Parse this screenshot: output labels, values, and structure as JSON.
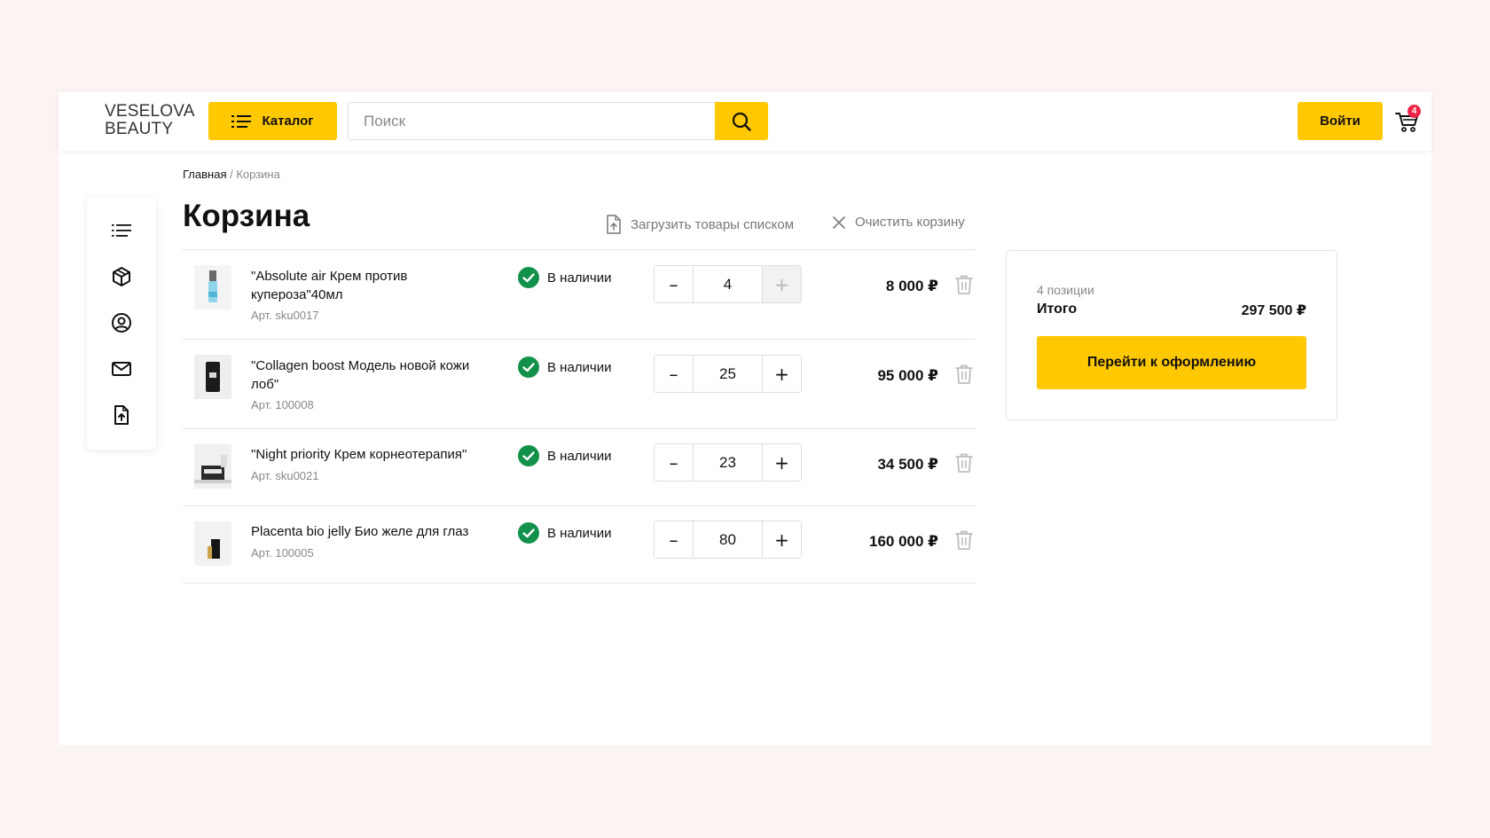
{
  "header": {
    "logo_line1": "VESELOVA",
    "logo_line2": "BEAUTY",
    "catalog_label": "Каталог",
    "search_placeholder": "Поиск",
    "login_label": "Войти",
    "cart_count": "4",
    "accent_color": "#ffc800",
    "badge_color": "#ee2244"
  },
  "sidebar": {
    "icons": [
      "list-icon",
      "box-icon",
      "user-circle-icon",
      "mail-icon",
      "file-upload-icon"
    ]
  },
  "breadcrumb": {
    "home": "Главная",
    "separator": " / ",
    "current": "Корзина"
  },
  "page": {
    "title": "Корзина",
    "upload_label": "Загрузить товары списком",
    "clear_label": "Очистить корзину"
  },
  "cart": {
    "items": [
      {
        "name": "\"Absolute air Крем против купероза\"40мл",
        "sku": "Арт. sku0017",
        "stock": "В наличии",
        "quantity": "4",
        "price": "8 000 ₽"
      },
      {
        "name": "\"Collagen boost Модель новой кожи лоб\"",
        "sku": "Арт. 100008",
        "stock": "В наличии",
        "quantity": "25",
        "price": "95 000 ₽"
      },
      {
        "name": "\"Night priority Крем корнеотерапия\"",
        "sku": "Арт. sku0021",
        "stock": "В наличии",
        "quantity": "23",
        "price": "34 500 ₽"
      },
      {
        "name": "Placenta bio jelly Био желе для глаз",
        "sku": "Арт. 100005",
        "stock": "В наличии",
        "quantity": "80",
        "price": "160 000 ₽"
      }
    ],
    "minus_symbol": "–",
    "plus_symbol": "+"
  },
  "summary": {
    "count_label": "4 позиции",
    "total_label": "Итого",
    "total_value": "297 500 ₽",
    "checkout_label": "Перейти к оформлению"
  }
}
